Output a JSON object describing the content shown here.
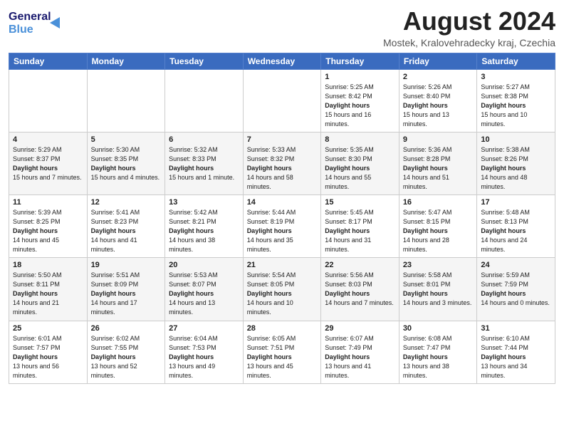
{
  "header": {
    "logo_line1": "General",
    "logo_line2": "Blue",
    "month_title": "August 2024",
    "location": "Mostek, Kralovehradecky kraj, Czechia"
  },
  "days_of_week": [
    "Sunday",
    "Monday",
    "Tuesday",
    "Wednesday",
    "Thursday",
    "Friday",
    "Saturday"
  ],
  "weeks": [
    [
      {
        "day": "",
        "info": ""
      },
      {
        "day": "",
        "info": ""
      },
      {
        "day": "",
        "info": ""
      },
      {
        "day": "",
        "info": ""
      },
      {
        "day": "1",
        "sunrise": "5:25 AM",
        "sunset": "8:42 PM",
        "daylight": "15 hours and 16 minutes."
      },
      {
        "day": "2",
        "sunrise": "5:26 AM",
        "sunset": "8:40 PM",
        "daylight": "15 hours and 13 minutes."
      },
      {
        "day": "3",
        "sunrise": "5:27 AM",
        "sunset": "8:38 PM",
        "daylight": "15 hours and 10 minutes."
      }
    ],
    [
      {
        "day": "4",
        "sunrise": "5:29 AM",
        "sunset": "8:37 PM",
        "daylight": "15 hours and 7 minutes."
      },
      {
        "day": "5",
        "sunrise": "5:30 AM",
        "sunset": "8:35 PM",
        "daylight": "15 hours and 4 minutes."
      },
      {
        "day": "6",
        "sunrise": "5:32 AM",
        "sunset": "8:33 PM",
        "daylight": "15 hours and 1 minute."
      },
      {
        "day": "7",
        "sunrise": "5:33 AM",
        "sunset": "8:32 PM",
        "daylight": "14 hours and 58 minutes."
      },
      {
        "day": "8",
        "sunrise": "5:35 AM",
        "sunset": "8:30 PM",
        "daylight": "14 hours and 55 minutes."
      },
      {
        "day": "9",
        "sunrise": "5:36 AM",
        "sunset": "8:28 PM",
        "daylight": "14 hours and 51 minutes."
      },
      {
        "day": "10",
        "sunrise": "5:38 AM",
        "sunset": "8:26 PM",
        "daylight": "14 hours and 48 minutes."
      }
    ],
    [
      {
        "day": "11",
        "sunrise": "5:39 AM",
        "sunset": "8:25 PM",
        "daylight": "14 hours and 45 minutes."
      },
      {
        "day": "12",
        "sunrise": "5:41 AM",
        "sunset": "8:23 PM",
        "daylight": "14 hours and 41 minutes."
      },
      {
        "day": "13",
        "sunrise": "5:42 AM",
        "sunset": "8:21 PM",
        "daylight": "14 hours and 38 minutes."
      },
      {
        "day": "14",
        "sunrise": "5:44 AM",
        "sunset": "8:19 PM",
        "daylight": "14 hours and 35 minutes."
      },
      {
        "day": "15",
        "sunrise": "5:45 AM",
        "sunset": "8:17 PM",
        "daylight": "14 hours and 31 minutes."
      },
      {
        "day": "16",
        "sunrise": "5:47 AM",
        "sunset": "8:15 PM",
        "daylight": "14 hours and 28 minutes."
      },
      {
        "day": "17",
        "sunrise": "5:48 AM",
        "sunset": "8:13 PM",
        "daylight": "14 hours and 24 minutes."
      }
    ],
    [
      {
        "day": "18",
        "sunrise": "5:50 AM",
        "sunset": "8:11 PM",
        "daylight": "14 hours and 21 minutes."
      },
      {
        "day": "19",
        "sunrise": "5:51 AM",
        "sunset": "8:09 PM",
        "daylight": "14 hours and 17 minutes."
      },
      {
        "day": "20",
        "sunrise": "5:53 AM",
        "sunset": "8:07 PM",
        "daylight": "14 hours and 13 minutes."
      },
      {
        "day": "21",
        "sunrise": "5:54 AM",
        "sunset": "8:05 PM",
        "daylight": "14 hours and 10 minutes."
      },
      {
        "day": "22",
        "sunrise": "5:56 AM",
        "sunset": "8:03 PM",
        "daylight": "14 hours and 7 minutes."
      },
      {
        "day": "23",
        "sunrise": "5:58 AM",
        "sunset": "8:01 PM",
        "daylight": "14 hours and 3 minutes."
      },
      {
        "day": "24",
        "sunrise": "5:59 AM",
        "sunset": "7:59 PM",
        "daylight": "14 hours and 0 minutes."
      }
    ],
    [
      {
        "day": "25",
        "sunrise": "6:01 AM",
        "sunset": "7:57 PM",
        "daylight": "13 hours and 56 minutes."
      },
      {
        "day": "26",
        "sunrise": "6:02 AM",
        "sunset": "7:55 PM",
        "daylight": "13 hours and 52 minutes."
      },
      {
        "day": "27",
        "sunrise": "6:04 AM",
        "sunset": "7:53 PM",
        "daylight": "13 hours and 49 minutes."
      },
      {
        "day": "28",
        "sunrise": "6:05 AM",
        "sunset": "7:51 PM",
        "daylight": "13 hours and 45 minutes."
      },
      {
        "day": "29",
        "sunrise": "6:07 AM",
        "sunset": "7:49 PM",
        "daylight": "13 hours and 41 minutes."
      },
      {
        "day": "30",
        "sunrise": "6:08 AM",
        "sunset": "7:47 PM",
        "daylight": "13 hours and 38 minutes."
      },
      {
        "day": "31",
        "sunrise": "6:10 AM",
        "sunset": "7:44 PM",
        "daylight": "13 hours and 34 minutes."
      }
    ]
  ]
}
